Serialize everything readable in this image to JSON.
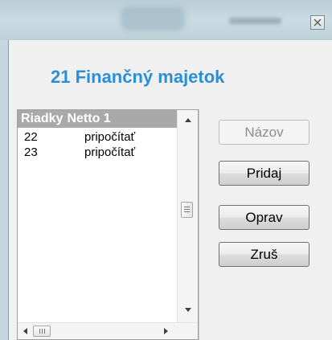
{
  "window": {
    "title_obscured": true,
    "close_icon": "close-icon"
  },
  "heading": "21 Finančný majetok",
  "list": {
    "columns": [
      "Riadky",
      "Netto 1"
    ],
    "rows": [
      {
        "id": "22",
        "action": "pripočítať"
      },
      {
        "id": "23",
        "action": "pripočítať"
      }
    ]
  },
  "buttons": {
    "name": "Názov",
    "add": "Pridaj",
    "edit": "Oprav",
    "delete": "Zruš"
  },
  "colors": {
    "heading": "#2b8fd8",
    "list_header_bg": "#a9a9a9"
  }
}
